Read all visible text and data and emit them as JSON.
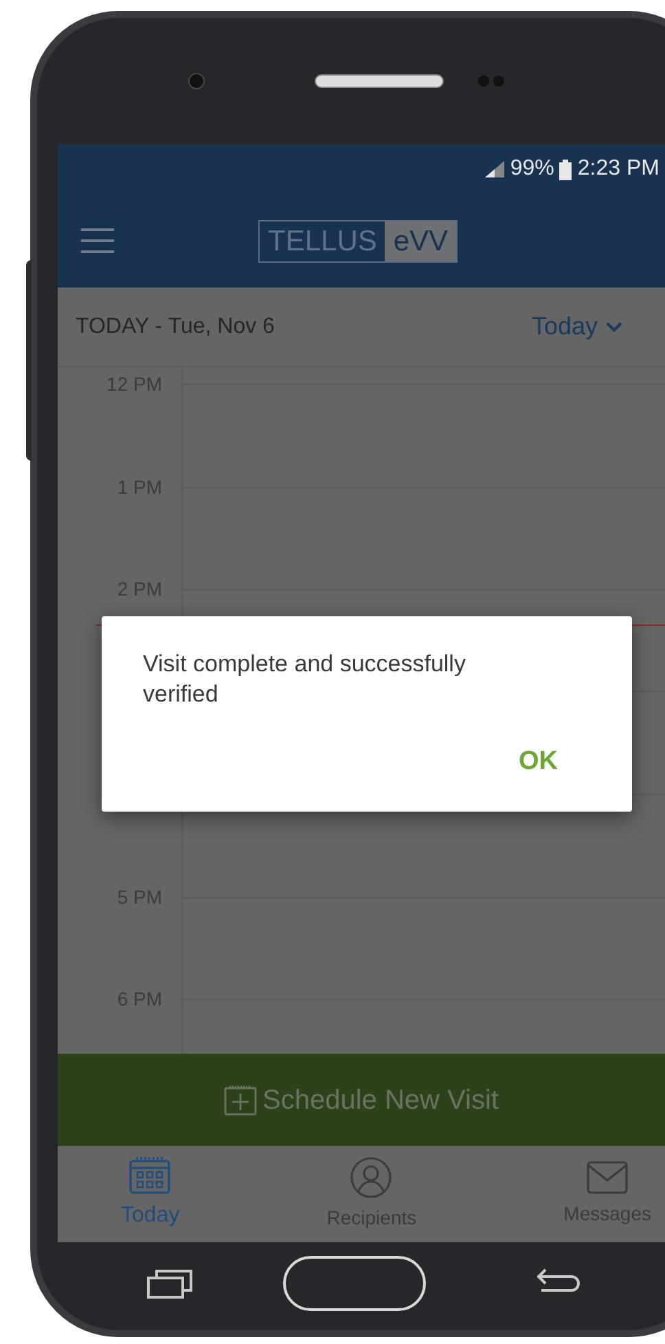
{
  "status_bar": {
    "battery": "99%",
    "time": "2:23 PM"
  },
  "app_bar": {
    "logo_left": "TELLUS",
    "logo_right": "eVV"
  },
  "date_bar": {
    "title": "TODAY - Tue, Nov 6",
    "picker": "Today"
  },
  "calendar": {
    "hours": [
      "12 PM",
      "1 PM",
      "2 PM",
      "5 PM",
      "6 PM"
    ]
  },
  "dialog": {
    "message": "Visit complete and successfully verified",
    "button": "OK"
  },
  "schedule_button": "Schedule New Visit",
  "bottom_nav": [
    {
      "kind": "calendar",
      "label": "Today",
      "selected": true
    },
    {
      "kind": "person",
      "label": "Recipients",
      "selected": false
    },
    {
      "kind": "mail",
      "label": "Messages",
      "selected": false
    }
  ]
}
